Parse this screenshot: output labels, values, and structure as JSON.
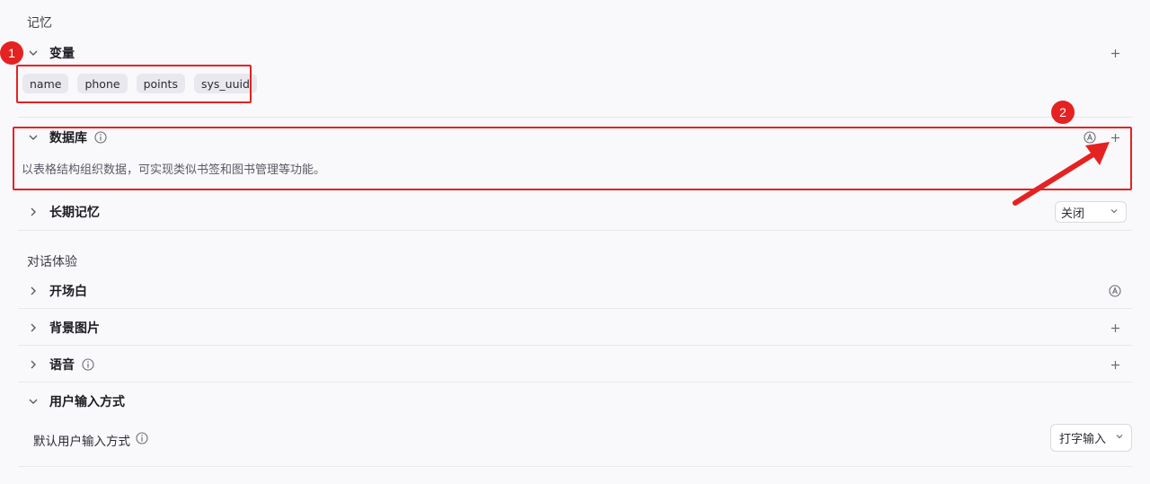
{
  "memory": {
    "section_title": "记忆",
    "variables": {
      "label": "变量",
      "tags": [
        "name",
        "phone",
        "points",
        "sys_uuid"
      ]
    },
    "database": {
      "label": "数据库",
      "description": "以表格结构组织数据，可实现类似书签和图书管理等功能。"
    },
    "long_term_memory": {
      "label": "长期记忆",
      "select_value": "关闭"
    }
  },
  "dialog": {
    "section_title": "对话体验",
    "opening": {
      "label": "开场白"
    },
    "background_image": {
      "label": "背景图片"
    },
    "voice": {
      "label": "语音"
    },
    "user_input": {
      "label": "用户输入方式",
      "default_label": "默认用户输入方式",
      "select_value": "打字输入"
    }
  },
  "annotations": {
    "badge_1": "1",
    "badge_2": "2",
    "accent_color": "#e52222"
  },
  "icons": {
    "chevron_down": "chevron-down-icon",
    "chevron_right": "chevron-right-icon",
    "plus": "plus-icon",
    "info": "info-icon",
    "auto": "auto-icon"
  }
}
